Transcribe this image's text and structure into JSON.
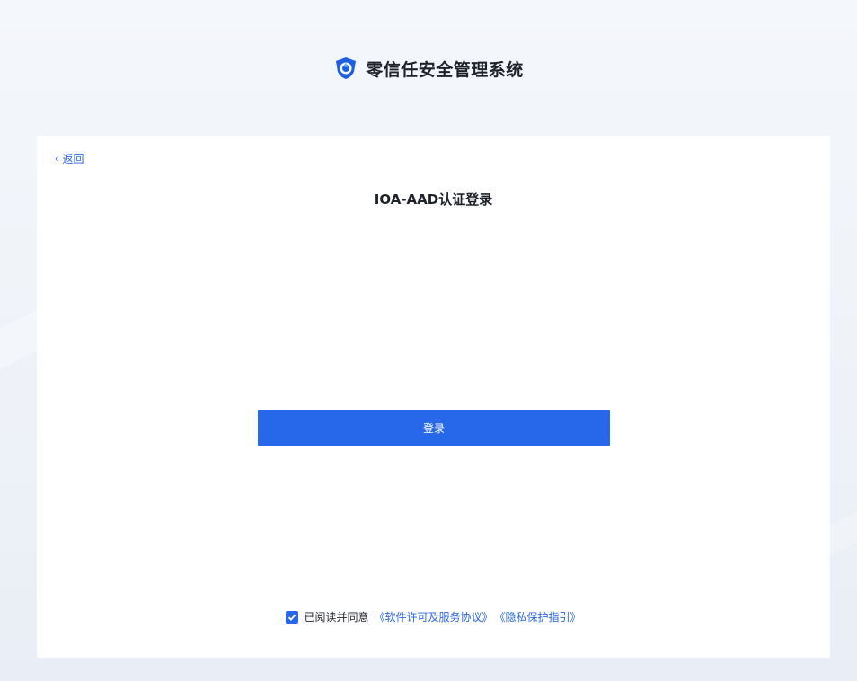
{
  "brand": {
    "title": "零信任安全管理系统"
  },
  "back": {
    "label": "返回"
  },
  "page": {
    "title": "IOA-AAD认证登录"
  },
  "login": {
    "button_label": "登录"
  },
  "agreement": {
    "checked": true,
    "text": "已阅读并同意",
    "license_link": "《软件许可及服务协议》",
    "privacy_link": "《隐私保护指引》"
  },
  "colors": {
    "accent": "#2768ea",
    "link": "#2a66e6",
    "text": "#1d2129"
  }
}
